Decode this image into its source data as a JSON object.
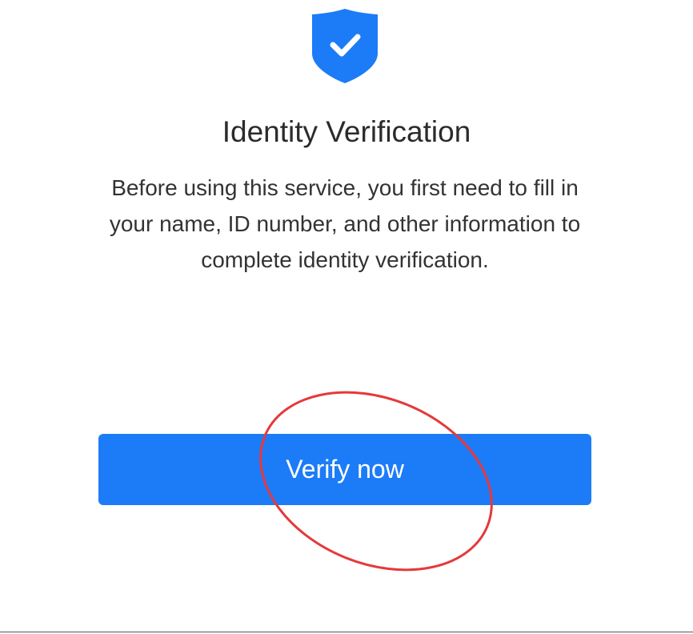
{
  "header": {
    "icon": "shield-check-icon",
    "title": "Identity Verification"
  },
  "main": {
    "description": "Before using this service, you first need to fill in your name, ID number, and other information to complete identity verification."
  },
  "actions": {
    "verify_label": "Verify now"
  },
  "colors": {
    "accent": "#1c7cf8",
    "annotation": "#e5393b"
  }
}
